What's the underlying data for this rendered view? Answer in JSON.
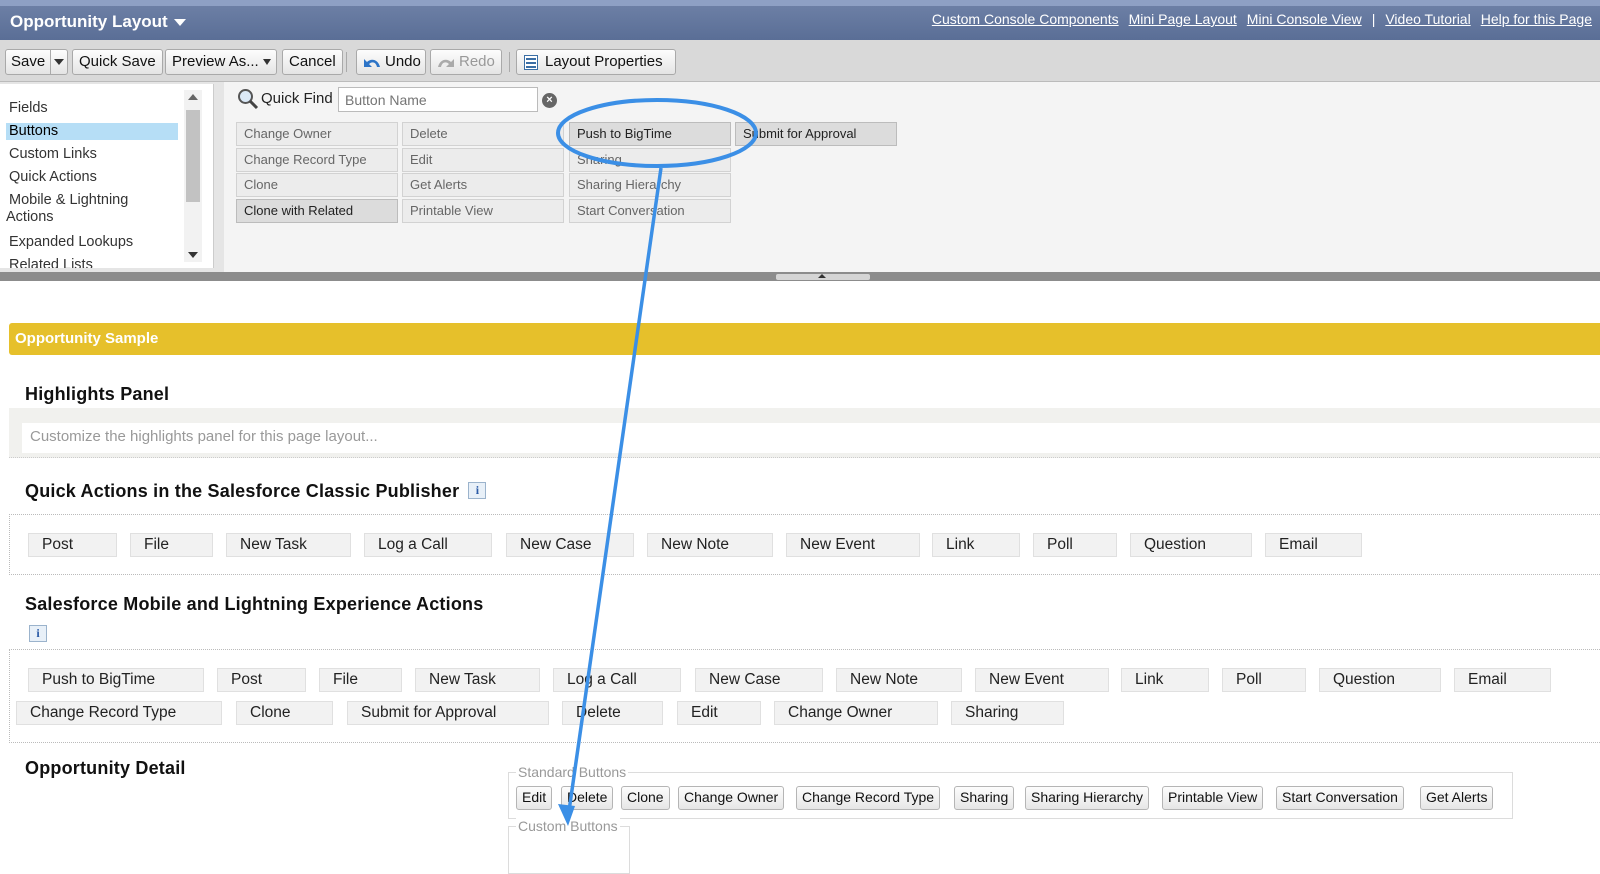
{
  "header": {
    "title": "Opportunity Layout",
    "links": [
      "Custom Console Components",
      "Mini Page Layout",
      "Mini Console View",
      "|",
      "Video Tutorial",
      "Help for this Page"
    ]
  },
  "toolbar": {
    "save": "Save",
    "quick_save": "Quick Save",
    "preview_as": "Preview As...",
    "cancel": "Cancel",
    "undo": "Undo",
    "redo": "Redo",
    "layout_properties": "Layout Properties"
  },
  "palette": {
    "categories": [
      "Fields",
      "Buttons",
      "Custom Links",
      "Quick Actions",
      "Mobile & Lightning",
      "Actions",
      "Expanded Lookups",
      "Related Lists"
    ],
    "selected_category": "Buttons",
    "quick_find_label": "Quick Find",
    "quick_find_placeholder": "Button Name",
    "buttons": [
      [
        "Change Owner",
        "Delete",
        "Push to BigTime",
        "Submit for Approval"
      ],
      [
        "Change Record Type",
        "Edit",
        "Sharing"
      ],
      [
        "Clone",
        "Get Alerts",
        "Sharing Hierarchy"
      ],
      [
        "Clone with Related",
        "Printable View",
        "Start Conversation"
      ]
    ]
  },
  "layout": {
    "sample_title": "Opportunity Sample",
    "highlights_title": "Highlights Panel",
    "highlights_hint": "Customize the highlights panel for this page layout...",
    "classic_publisher_title": "Quick Actions in the Salesforce Classic Publisher",
    "classic_actions": [
      "Post",
      "File",
      "New Task",
      "Log a Call",
      "New Case",
      "New Note",
      "New Event",
      "Link",
      "Poll",
      "Question",
      "Email"
    ],
    "mobile_title": "Salesforce Mobile and Lightning Experience Actions",
    "mobile_actions_row1": [
      "Push to BigTime",
      "Post",
      "File",
      "New Task",
      "Log a Call",
      "New Case",
      "New Note",
      "New Event",
      "Link",
      "Poll",
      "Question",
      "Email"
    ],
    "mobile_actions_row2": [
      "Change Record Type",
      "Clone",
      "Submit for Approval",
      "Delete",
      "Edit",
      "Change Owner",
      "Sharing"
    ],
    "detail_title": "Opportunity Detail",
    "standard_buttons_legend": "Standard Buttons",
    "standard_buttons": [
      "Edit",
      "Delete",
      "Clone",
      "Change Owner",
      "Change Record Type",
      "Sharing",
      "Sharing Hierarchy",
      "Printable View",
      "Start Conversation",
      "Get Alerts"
    ],
    "custom_buttons_legend": "Custom Buttons",
    "info_icon_glyph": "i"
  },
  "colors": {
    "header": "#5a6e96",
    "sample_bar": "#e6c02b",
    "selected_category": "#b6def6",
    "annotation": "#3b8fe6"
  }
}
